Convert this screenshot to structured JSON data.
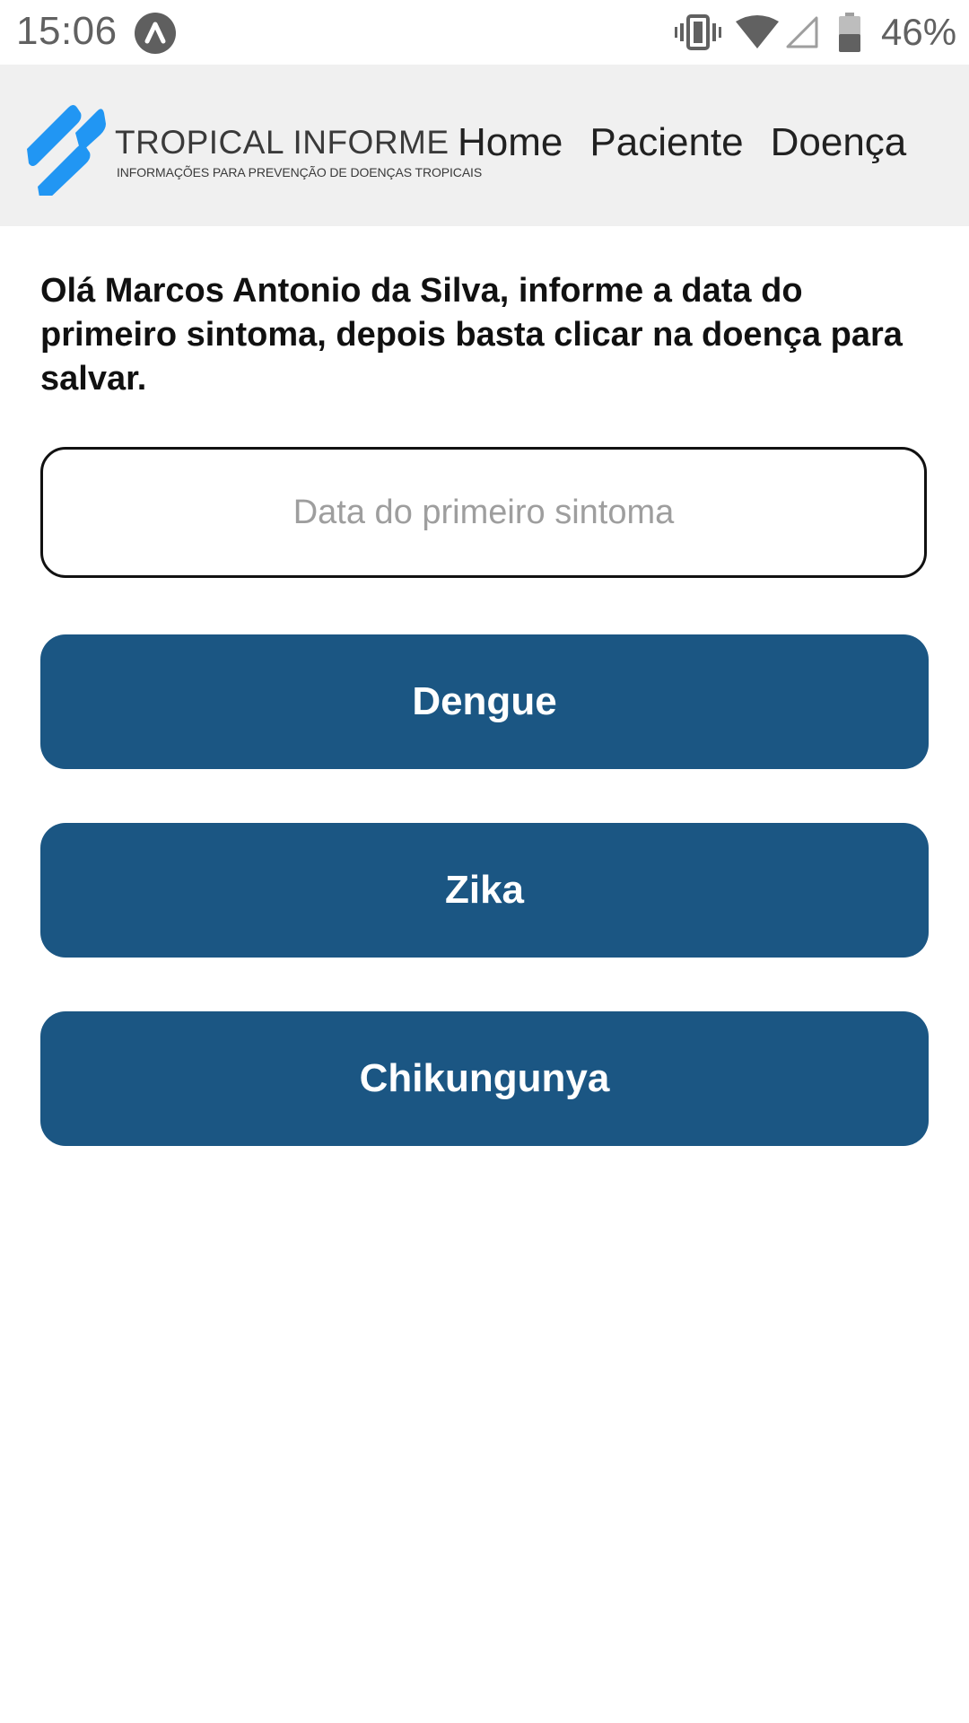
{
  "status_bar": {
    "time": "15:06",
    "battery_percent": "46%",
    "icons": [
      "app-notification-icon",
      "vibrate-icon",
      "wifi-icon",
      "cell-signal-icon",
      "battery-icon"
    ]
  },
  "header": {
    "logo": {
      "title": "TROPICAL INFORME",
      "subtitle": "INFORMAÇÕES PARA PREVENÇÃO DE DOENÇAS TROPICAIS",
      "color": "#2196f3"
    },
    "nav": [
      {
        "label": "Home"
      },
      {
        "label": "Paciente"
      },
      {
        "label": "Doença"
      }
    ]
  },
  "main": {
    "intro_text": "Olá Marcos Antonio da Silva, informe a data do primeiro sintoma, depois basta clicar na doença para salvar.",
    "date_input": {
      "value": "",
      "placeholder": "Data do primeiro sintoma"
    },
    "disease_buttons": [
      {
        "label": "Dengue"
      },
      {
        "label": "Zika"
      },
      {
        "label": "Chikungunya"
      }
    ]
  },
  "colors": {
    "header_background": "#f0f0f0",
    "button_background": "#1b5683",
    "button_text": "#ffffff",
    "logo_accent": "#2196f3"
  }
}
